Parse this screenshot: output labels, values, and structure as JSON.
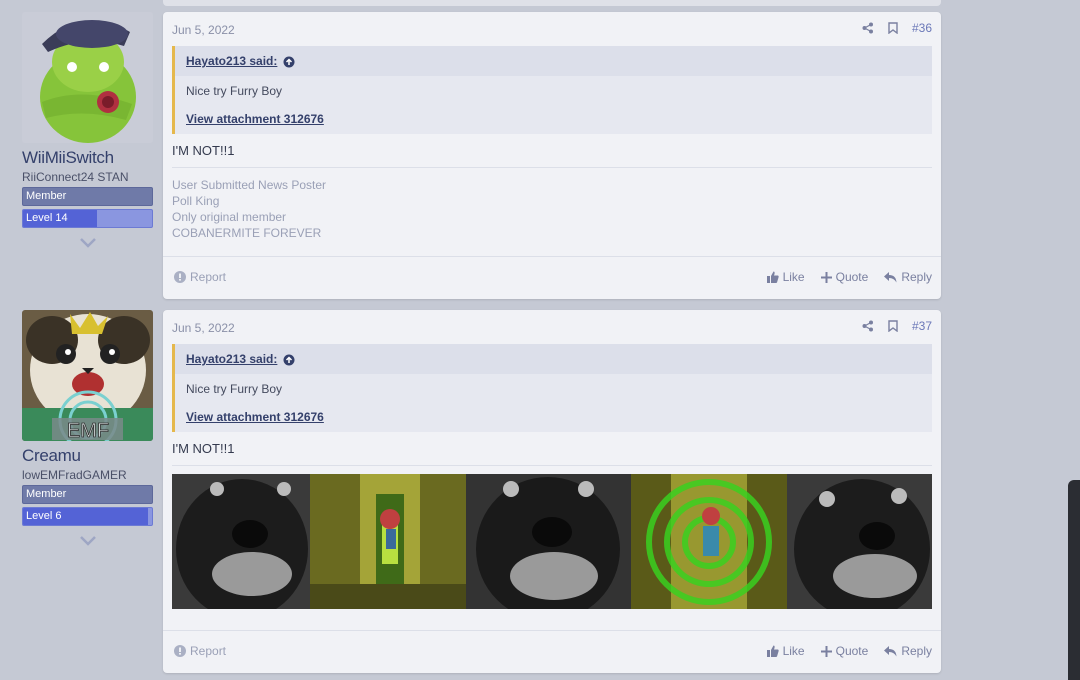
{
  "posts": [
    {
      "username": "WiiMiiSwitch",
      "user_title": "RiiConnect24 STAN",
      "member_badge": "Member",
      "level_badge": "Level 14",
      "level_progress": 0.57,
      "date": "Jun 5, 2022",
      "post_number": "#36",
      "quote_author": "Hayato213 said:",
      "quote_text": "Nice try Furry Boy",
      "quote_attachment": "View attachment 312676",
      "message": "I'M NOT!!1",
      "signature": [
        "User Submitted News Poster",
        "Poll King",
        "Only original member",
        "COBANERMITE FOREVER"
      ],
      "actions": {
        "report": "Report",
        "like": "Like",
        "quote": "Quote",
        "reply": "Reply"
      }
    },
    {
      "username": "Creamu",
      "user_title": "lowEMFradGAMER",
      "member_badge": "Member",
      "level_badge": "Level 6",
      "level_progress": 0.97,
      "date": "Jun 5, 2022",
      "post_number": "#37",
      "quote_author": "Hayato213 said:",
      "quote_text": "Nice try Furry Boy",
      "quote_attachment": "View attachment 312676",
      "message": "I'M NOT!!1",
      "avatar_text": "EMF",
      "actions": {
        "report": "Report",
        "like": "Like",
        "quote": "Quote",
        "reply": "Reply"
      }
    }
  ],
  "colors": {
    "quote_accent": "#e5b84c",
    "link": "#34406b",
    "level_badge": "#5463d6"
  }
}
